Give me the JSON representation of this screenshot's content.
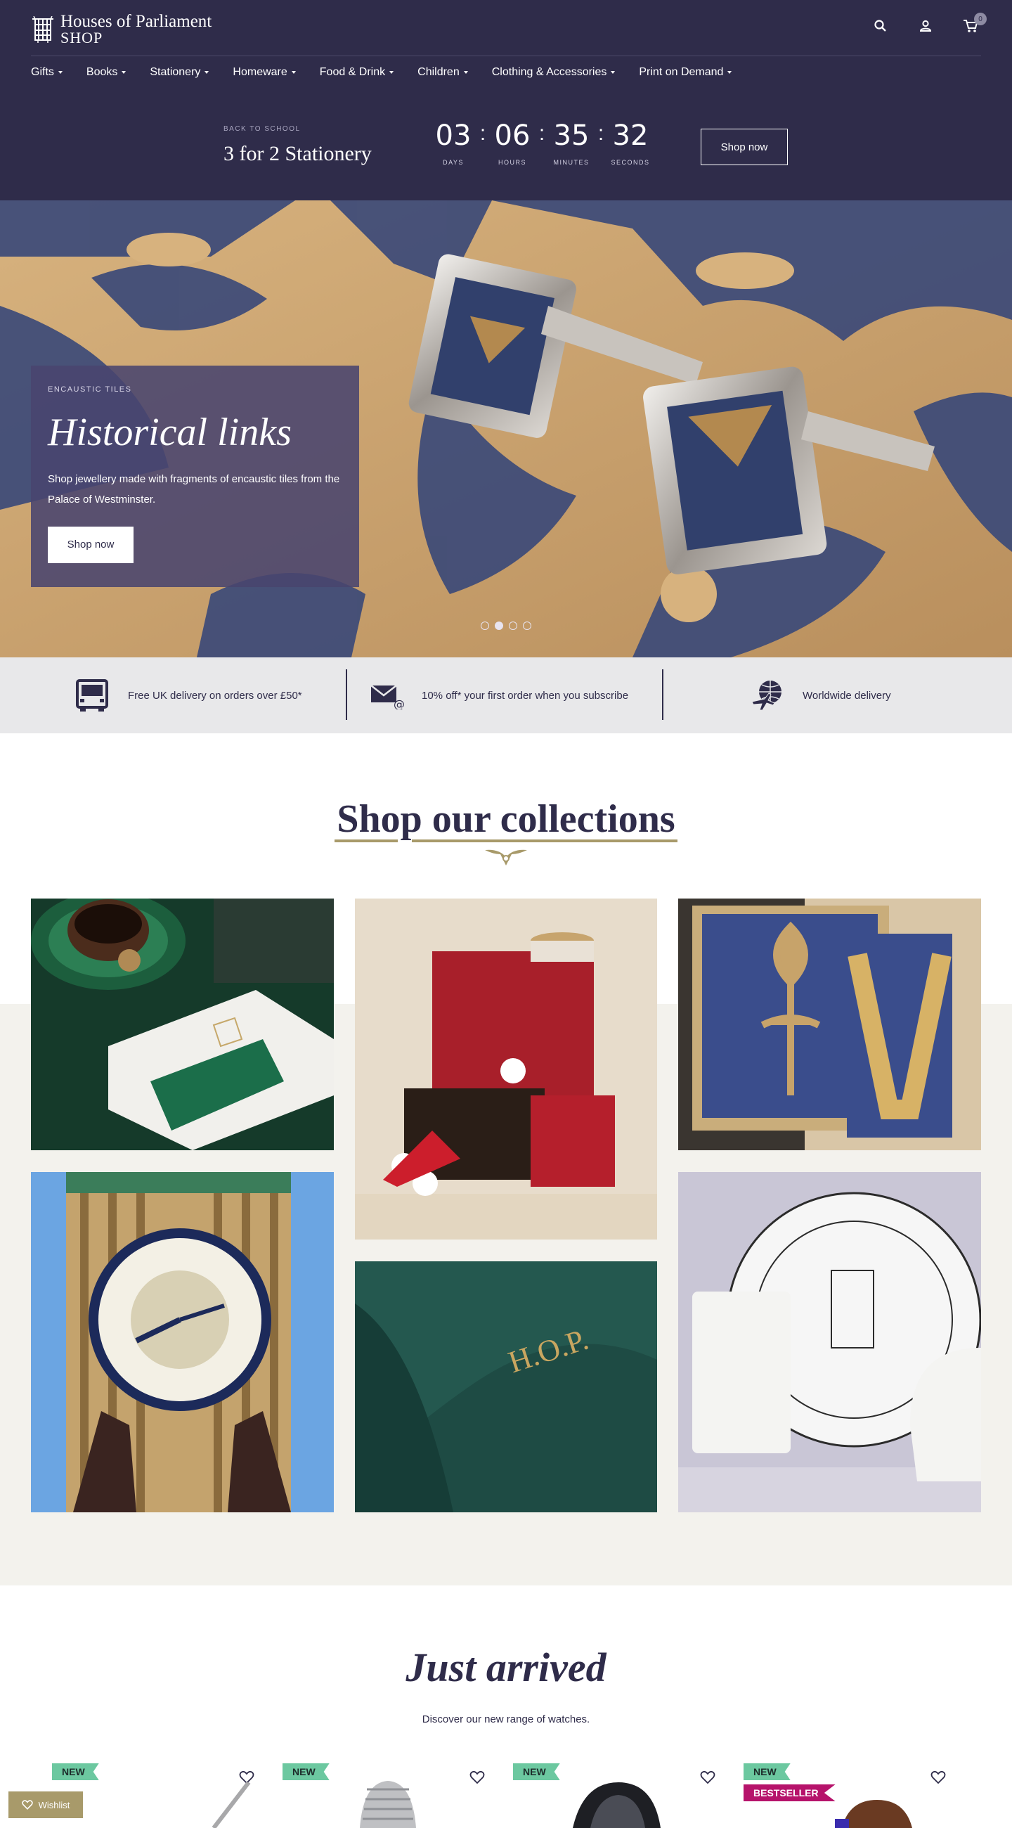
{
  "header": {
    "logo_line1": "Houses of Parliament",
    "logo_line2": "SHOP",
    "cart_count": "0",
    "nav": [
      "Gifts",
      "Books",
      "Stationery",
      "Homeware",
      "Food & Drink",
      "Children",
      "Clothing & Accessories",
      "Print on Demand"
    ]
  },
  "promo": {
    "eyebrow": "BACK TO SCHOOL",
    "title": "3 for 2 Stationery",
    "countdown": {
      "days": "03",
      "hours": "06",
      "minutes": "35",
      "seconds": "32",
      "days_label": "DAYS",
      "hours_label": "HOURS",
      "minutes_label": "MINUTES",
      "seconds_label": "SECONDS"
    },
    "button": "Shop now"
  },
  "hero": {
    "eyebrow": "ENCAUSTIC TILES",
    "title": "Historical links",
    "description": "Shop jewellery made with fragments of encaustic tiles from the Palace of Westminster.",
    "button": "Shop now",
    "slides": 4,
    "active_slide": 2
  },
  "usp": {
    "delivery": "Free UK delivery on orders over £50*",
    "subscribe": "10% off* your first order when you subscribe",
    "worldwide": "Worldwide delivery"
  },
  "collections": {
    "title": "Shop our collections"
  },
  "just_arrived": {
    "title": "Just arrived",
    "subtitle": "Discover our new range of watches.",
    "badge_new": "NEW",
    "badge_bestseller": "BESTSELLER",
    "wishlist": "Wishlist"
  },
  "colors": {
    "navy": "#2f2c4a",
    "gold": "#a89a6a",
    "new_badge": "#6cc8a0",
    "bestseller_badge": "#b6136b"
  }
}
